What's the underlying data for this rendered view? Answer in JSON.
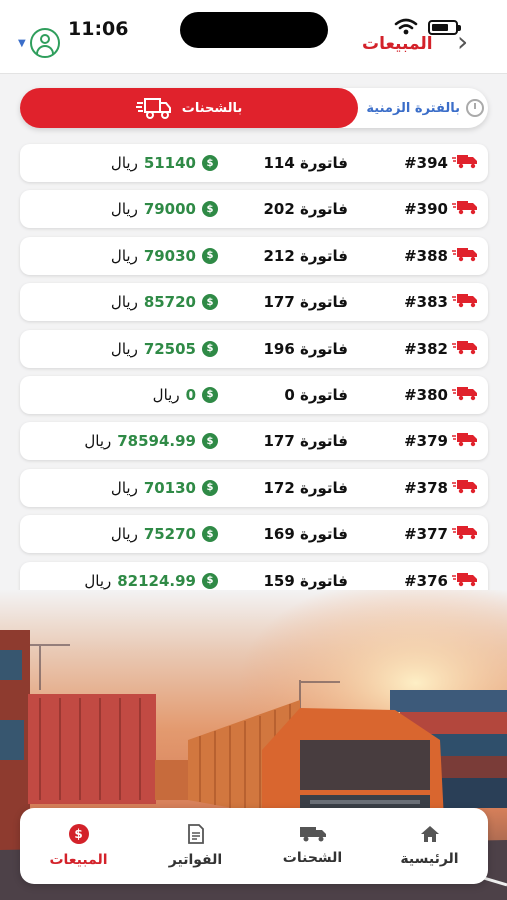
{
  "status_bar": {
    "time": "11:06"
  },
  "header": {
    "title": "المبيعات"
  },
  "segments": {
    "active_label": "بالشحنات",
    "other_label": "بالفترة الزمنية"
  },
  "rows": [
    {
      "id": "#394",
      "invoices": "114 فاتورة",
      "amount": "51140",
      "currency": "ريال"
    },
    {
      "id": "#390",
      "invoices": "202 فاتورة",
      "amount": "79000",
      "currency": "ريال"
    },
    {
      "id": "#388",
      "invoices": "212 فاتورة",
      "amount": "79030",
      "currency": "ريال"
    },
    {
      "id": "#383",
      "invoices": "177 فاتورة",
      "amount": "85720",
      "currency": "ريال"
    },
    {
      "id": "#382",
      "invoices": "196 فاتورة",
      "amount": "72505",
      "currency": "ريال"
    },
    {
      "id": "#380",
      "invoices": "0 فاتورة",
      "amount": "0",
      "currency": "ريال"
    },
    {
      "id": "#379",
      "invoices": "177 فاتورة",
      "amount": "78594.99",
      "currency": "ريال"
    },
    {
      "id": "#378",
      "invoices": "172 فاتورة",
      "amount": "70130",
      "currency": "ريال"
    },
    {
      "id": "#377",
      "invoices": "169 فاتورة",
      "amount": "75270",
      "currency": "ريال"
    },
    {
      "id": "#376",
      "invoices": "159 فاتورة",
      "amount": "82124.99",
      "currency": "ريال"
    }
  ],
  "tabs": [
    {
      "label": "الرئيسية",
      "icon": "home-icon"
    },
    {
      "label": "الشحنات",
      "icon": "truck-icon"
    },
    {
      "label": "الفواتير",
      "icon": "invoice-icon"
    },
    {
      "label": "المبيعات",
      "icon": "sales-icon",
      "active": true
    }
  ],
  "colors": {
    "accent": "#e0222c",
    "money": "#2f8a46",
    "link": "#3b6ec9"
  }
}
